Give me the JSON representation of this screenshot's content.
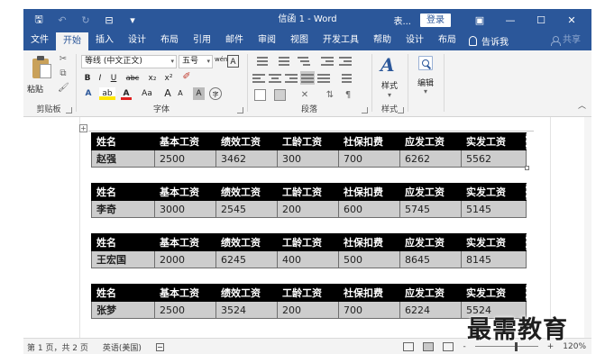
{
  "titlebar": {
    "title": "信函 1 - Word",
    "ellipsis": "表...",
    "login": "登录",
    "save_icon": "save-icon",
    "undo_icon": "undo-icon",
    "redo_icon": "redo-icon",
    "qat_icon": "quick-access-icon",
    "customize_icon": "customize-icon"
  },
  "tabs": [
    "文件",
    "开始",
    "插入",
    "设计",
    "布局",
    "引用",
    "邮件",
    "审阅",
    "视图",
    "开发工具",
    "帮助",
    "设计",
    "布局"
  ],
  "active_tab": "开始",
  "tell_me": "告诉我",
  "share": "共享",
  "ribbon": {
    "clipboard": {
      "label": "剪贴板",
      "paste": "粘贴"
    },
    "font": {
      "label": "字体",
      "font_name": "等线 (中文正文)",
      "font_size": "五号",
      "wen": "wén",
      "bold": "B",
      "italic": "I",
      "underline": "U",
      "strike": "abc",
      "subscript": "x₂",
      "superscript": "x²",
      "text_effect": "A",
      "highlight": "ab",
      "font_color": "A",
      "change_case": "Aa",
      "grow": "A",
      "shrink": "A",
      "char_shading": "A",
      "enclose": "字"
    },
    "paragraph": {
      "label": "段落"
    },
    "styles": {
      "label": "样式",
      "button": "样式"
    },
    "editing": {
      "button": "编辑"
    }
  },
  "table_headers": [
    "姓名",
    "基本工资",
    "绩效工资",
    "工龄工资",
    "社保扣费",
    "应发工资",
    "实发工资"
  ],
  "tables": [
    {
      "row": [
        "赵强",
        "2500",
        "3462",
        "300",
        "700",
        "6262",
        "5562"
      ]
    },
    {
      "row": [
        "李奇",
        "3000",
        "2545",
        "200",
        "600",
        "5745",
        "5145"
      ]
    },
    {
      "row": [
        "王宏国",
        "2000",
        "6245",
        "400",
        "500",
        "8645",
        "8145"
      ]
    },
    {
      "row": [
        "张梦",
        "2500",
        "3524",
        "200",
        "700",
        "6224",
        "5524"
      ]
    }
  ],
  "statusbar": {
    "page_info": "第 1 页，共 2 页",
    "language": "英语(美国)",
    "zoom": "120%",
    "zoom_minus": "-",
    "zoom_plus": "+"
  },
  "watermark": "最需教育",
  "colors": {
    "accent": "#2b579a",
    "table_header": "#000000",
    "table_row": "#cdcdcd"
  }
}
